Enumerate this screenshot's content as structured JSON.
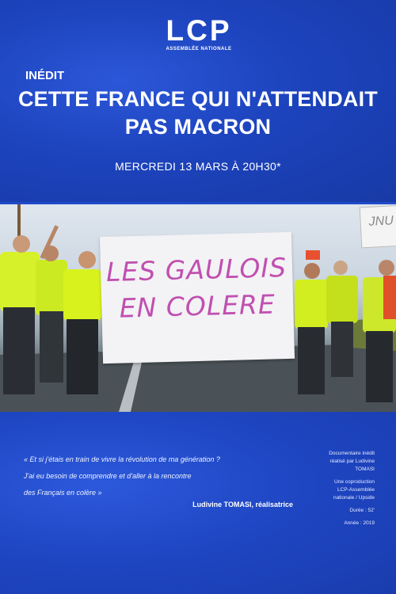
{
  "header": {
    "logo_main": "LCP",
    "logo_sub": "ASSEMBLÉE NATIONALE",
    "kicker": "INÉDIT",
    "title_line1": "CETTE FRANCE QUI N'ATTENDAIT",
    "title_line2": "PAS MACRON",
    "date": "MERCREDI 13 MARS À 20H30*"
  },
  "photo": {
    "banner_line1": "LES GAULOIS",
    "banner_line2": "EN COLERE",
    "sign_right": "JNU"
  },
  "footer": {
    "quote_line1": "« Et si j'étais en train de vivre la révolution de ma génération ?",
    "quote_line2": "J'ai eu besoin de comprendre et d'aller à la rencontre",
    "quote_line3": "des Français en colère »",
    "author": "Ludivine TOMASI, réalisatrice",
    "credit1_line1": "Documentaire inédit",
    "credit1_line2": "réalisé par Ludivine",
    "credit1_line3": "TOMASI",
    "credit2_line1": "Une coproduction",
    "credit2_line2": "LCP-Assemblée",
    "credit2_line3": "nationale / Upside",
    "credit3": "Durée : 52'",
    "credit4": "Année : 2019"
  },
  "colors": {
    "brand_blue": "#1d43bd",
    "banner_text": "#c04fb0",
    "vest_yellow": "#d8f21e"
  }
}
